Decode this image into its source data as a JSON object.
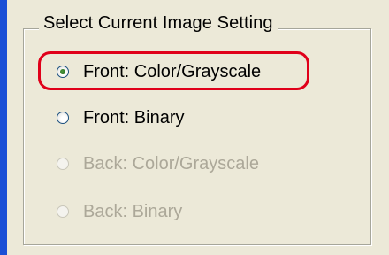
{
  "group": {
    "title": "Select Current Image Setting"
  },
  "options": [
    {
      "label": "Front: Color/Grayscale",
      "checked": true,
      "enabled": true
    },
    {
      "label": "Front: Binary",
      "checked": false,
      "enabled": true
    },
    {
      "label": "Back: Color/Grayscale",
      "checked": false,
      "enabled": false
    },
    {
      "label": "Back: Binary",
      "checked": false,
      "enabled": false
    }
  ],
  "colors": {
    "highlight": "#e0001a",
    "window_background": "#ece9d8",
    "left_bar": "#1a4fd6",
    "disabled_text": "#aca899"
  }
}
